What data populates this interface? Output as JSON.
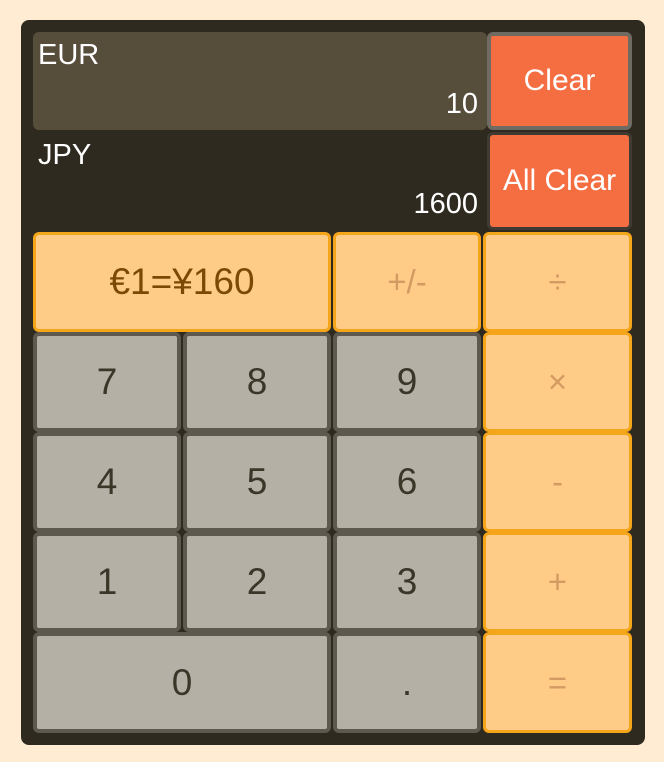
{
  "displays": {
    "source": {
      "currency": "EUR",
      "amount": "10"
    },
    "target": {
      "currency": "JPY",
      "amount": "1600"
    }
  },
  "controls": {
    "clear_label": "Clear",
    "all_clear_label": "All Clear"
  },
  "rate_label": "€1=¥160",
  "operators": {
    "negate": "+/-",
    "divide": "÷",
    "multiply": "×",
    "subtract": "-",
    "add": "+",
    "equals": "="
  },
  "digits": {
    "d0": "0",
    "d1": "1",
    "d2": "2",
    "d3": "3",
    "d4": "4",
    "d5": "5",
    "d6": "6",
    "d7": "7",
    "d8": "8",
    "d9": "9",
    "decimal": "."
  },
  "colors": {
    "accent_clear": "#f46e42",
    "operator_bg": "#ffcc88",
    "operator_border": "#f4a51a",
    "digit_bg": "#b4b0a6",
    "body_bg": "#2e2a1f",
    "page_bg": "#ffecd2"
  }
}
